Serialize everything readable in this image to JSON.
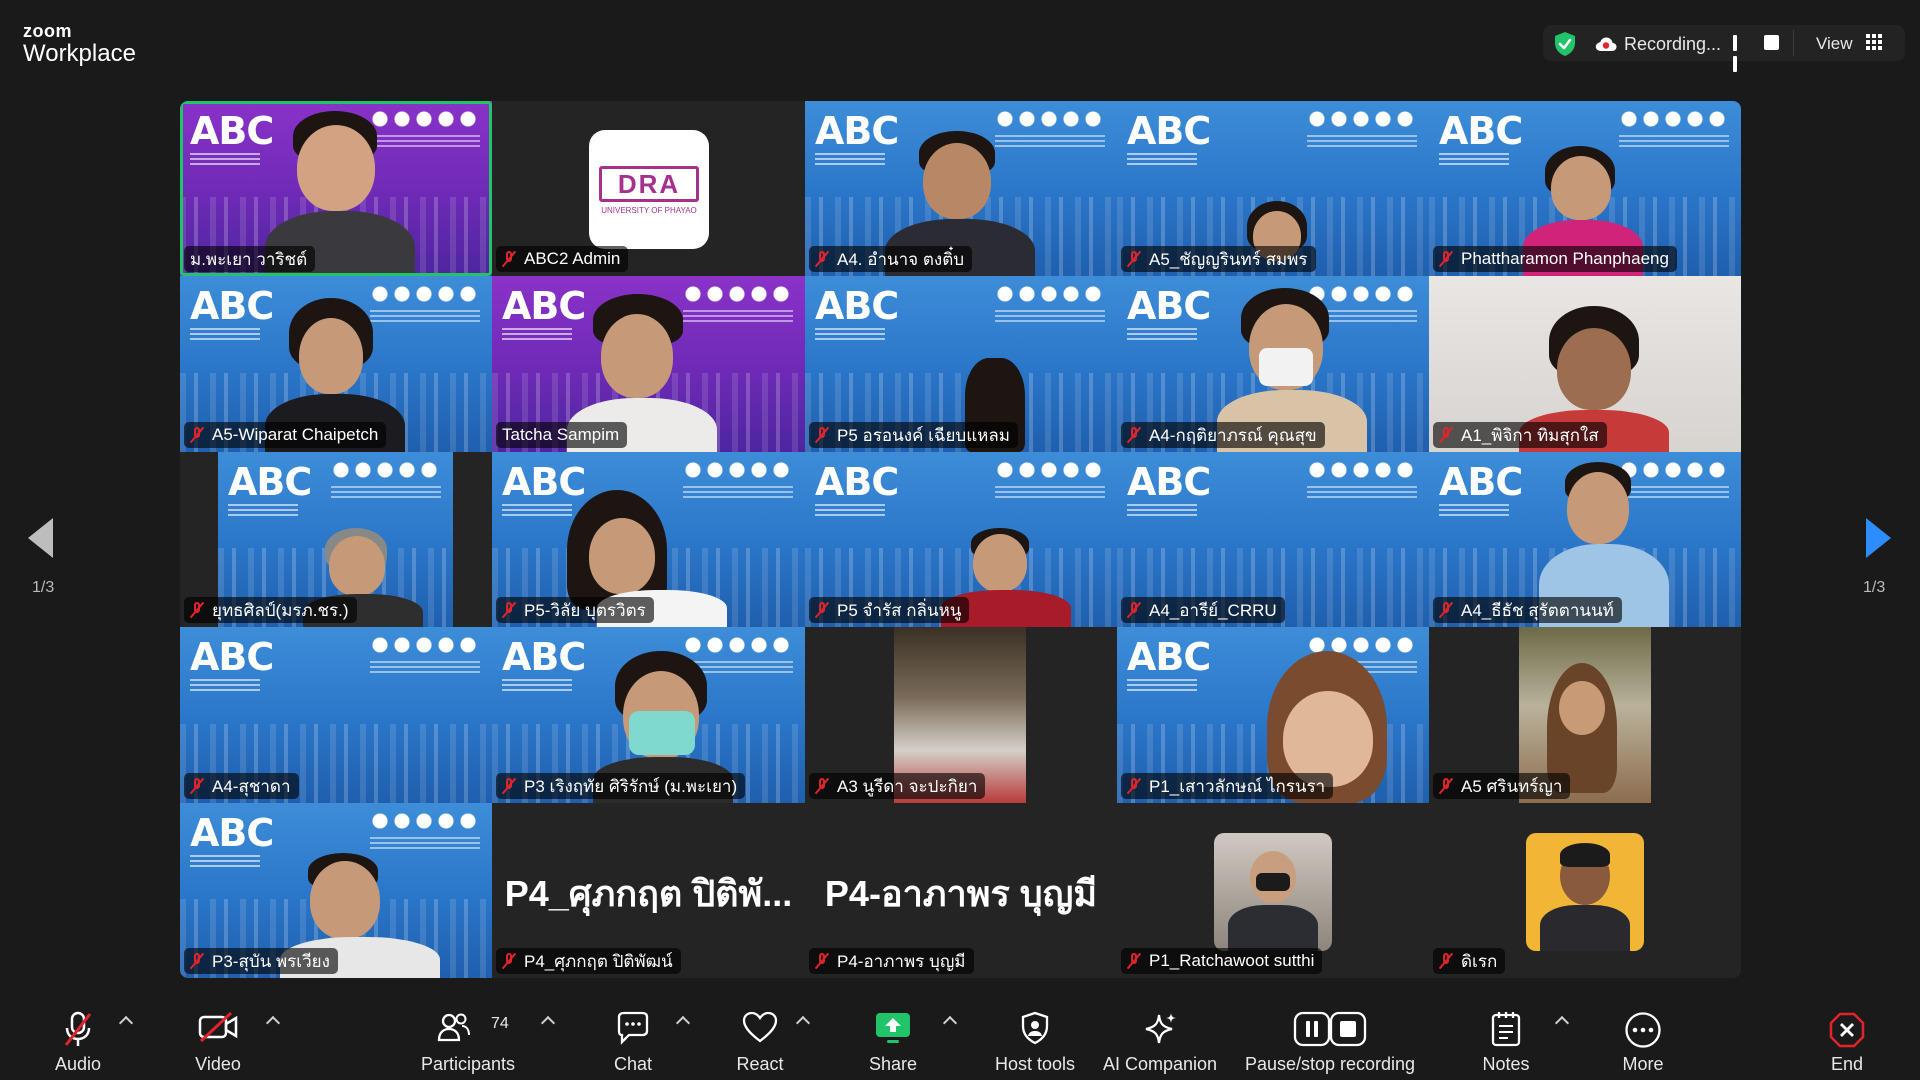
{
  "app": {
    "logo_line1": "zoom",
    "logo_line2": "Workplace"
  },
  "topbar": {
    "recording_label": "Recording...",
    "view_label": "View"
  },
  "pager": {
    "left": "1/3",
    "right": "1/3"
  },
  "participants": [
    {
      "name": "ม.พะเยา วาริชต์",
      "muted": false
    },
    {
      "name": "ABC2 Admin",
      "muted": true
    },
    {
      "name": "A4. อำนาจ ตงติ๋บ",
      "muted": true
    },
    {
      "name": "A5_ชัญญรินทร์ สมพร",
      "muted": true
    },
    {
      "name": "Phattharamon Phanphaeng",
      "muted": true
    },
    {
      "name": "A5-Wiparat Chaipetch",
      "muted": true
    },
    {
      "name": "Tatcha Sampim",
      "muted": false
    },
    {
      "name": "P5 อรอนงค์ เฉียบแหลม",
      "muted": true
    },
    {
      "name": "A4-กฤติยาภรณ์ คุณสุข",
      "muted": true
    },
    {
      "name": "A1_พิจิกา ทิมสุกใส",
      "muted": true
    },
    {
      "name": "ยุทธศิลป์(มรภ.ชร.)",
      "muted": true
    },
    {
      "name": "P5-วิลัย บุตรวิตร",
      "muted": true
    },
    {
      "name": "P5 จำรัส กลิ่นหนู",
      "muted": true
    },
    {
      "name": "A4_อารีย์_CRRU",
      "muted": true
    },
    {
      "name": "A4_ธีธัช สุรัตตานนท์",
      "muted": true
    },
    {
      "name": "A4-สุชาดา",
      "muted": true
    },
    {
      "name": "P3 เริงฤทัย ศิริรักษ์ (ม.พะเยา)",
      "muted": true
    },
    {
      "name": "A3 นูรีดา จะปะกิยา",
      "muted": true
    },
    {
      "name": "P1_เสาวลักษณ์ ไกรนรา",
      "muted": true
    },
    {
      "name": "A5 ศรินทร์ญา",
      "muted": true
    },
    {
      "name": "P3-สุบัน พรเวียง",
      "muted": true
    },
    {
      "name": "P4_ศุภกฤต ปิติพัฒน์",
      "muted": true,
      "display_text": "P4_ศุภกฤต ปิติพั..."
    },
    {
      "name": "P4-อาภาพร บุญมี",
      "muted": true,
      "display_text": "P4-อาภาพร บุญมี"
    },
    {
      "name": "P1_Ratchawoot sutthi",
      "muted": true
    },
    {
      "name": "ดิเรก",
      "muted": true
    }
  ],
  "dra_card": {
    "title": "DRA",
    "subtitle": "UNIVERSITY OF PHAYAO"
  },
  "toolbar": {
    "audio": "Audio",
    "video": "Video",
    "participants": "Participants",
    "participants_count": "74",
    "chat": "Chat",
    "react": "React",
    "share": "Share",
    "host_tools": "Host tools",
    "ai_companion": "AI Companion",
    "pause_stop": "Pause/stop recording",
    "notes": "Notes",
    "more": "More",
    "end": "End"
  },
  "colors": {
    "accent": "#2d8cff",
    "share_green": "#22c46a",
    "mute_red": "#e0242b",
    "end_red": "#e0242b",
    "active_speaker": "#22c46a"
  }
}
